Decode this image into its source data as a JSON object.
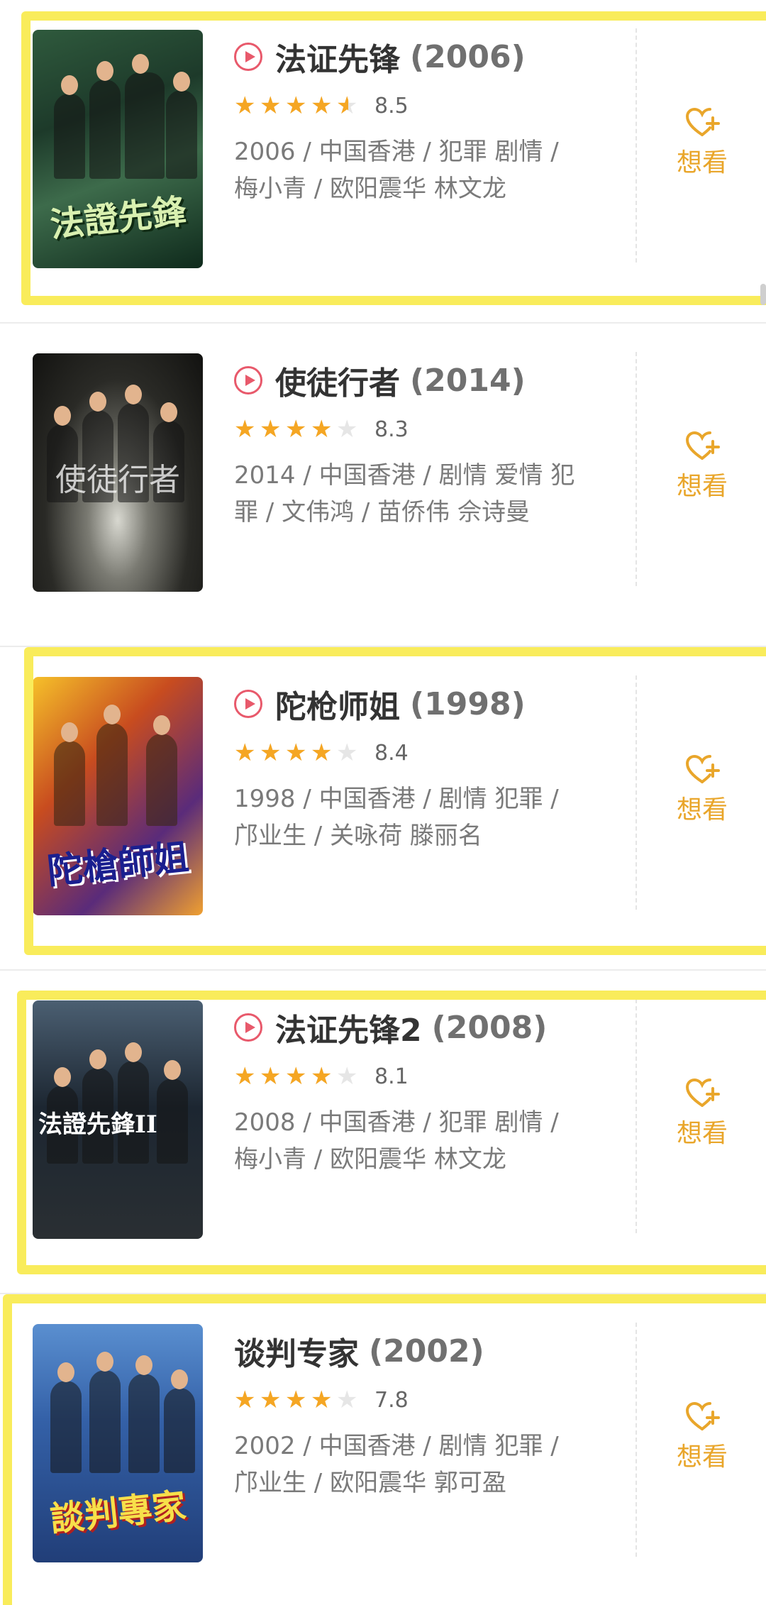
{
  "movies": [
    {
      "title": "法证先锋",
      "year": "(2006)",
      "has_play": true,
      "stars": 4.5,
      "score": "8.5",
      "meta_line1": "2006 / 中国香港 / 犯罪 剧情 /",
      "meta_line2": "梅小青 / 欧阳震华 林文龙",
      "poster_text": "法證先鋒",
      "want": "想看",
      "highlighted": true
    },
    {
      "title": "使徒行者",
      "year": "(2014)",
      "has_play": true,
      "stars": 4,
      "score": "8.3",
      "meta_line1": "2014 / 中国香港 / 剧情 爱情 犯",
      "meta_line2": "罪 / 文伟鸿 / 苗侨伟 佘诗曼",
      "poster_text": "使徒行者",
      "want": "想看",
      "highlighted": false
    },
    {
      "title": "陀枪师姐",
      "year": "(1998)",
      "has_play": true,
      "stars": 4,
      "score": "8.4",
      "meta_line1": "1998 / 中国香港 / 剧情 犯罪 /",
      "meta_line2": "邝业生 / 关咏荷 滕丽名",
      "poster_text": "陀槍師姐",
      "want": "想看",
      "highlighted": true
    },
    {
      "title": "法证先锋2",
      "year": "(2008)",
      "has_play": true,
      "stars": 4,
      "score": "8.1",
      "meta_line1": "2008 / 中国香港 / 犯罪 剧情 /",
      "meta_line2": "梅小青 / 欧阳震华 林文龙",
      "poster_text": "法證先鋒II",
      "want": "想看",
      "highlighted": true
    },
    {
      "title": "谈判专家",
      "year": "(2002)",
      "has_play": false,
      "stars": 4,
      "score": "7.8",
      "meta_line1": "2002 / 中国香港 / 剧情 犯罪 /",
      "meta_line2": "邝业生 / 欧阳震华 郭可盈",
      "poster_text": "談判專家",
      "want": "想看",
      "highlighted": true
    }
  ],
  "colors": {
    "highlight_border": "#f9ec5b",
    "star": "#f5a623",
    "play": "#e8596b",
    "want": "#e9a62b"
  },
  "icons": {
    "play": "play-circle-icon",
    "want": "heart-plus-icon",
    "star": "star-icon"
  }
}
